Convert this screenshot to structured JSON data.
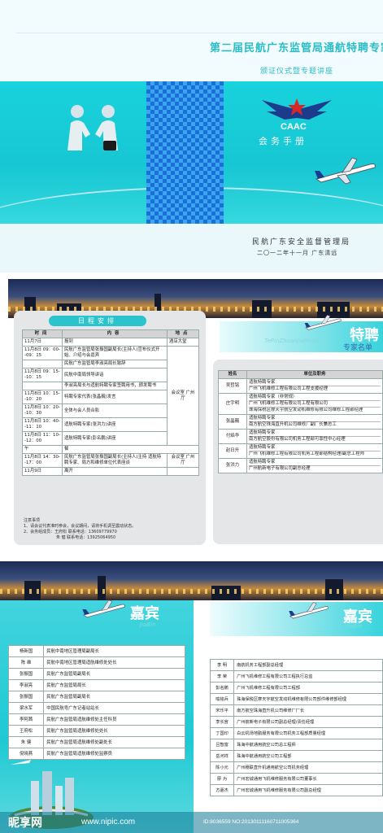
{
  "cover": {
    "title": "第二届民航广东监管局通航特聘专家",
    "subtitle": "颁证仪式暨专题讲座",
    "logo_text": "CAAC",
    "handbook": "会务手册",
    "org": "民航广东安全监督管理局",
    "date": "二〇一二年十一月  广东清远"
  },
  "schedule": {
    "header": "日程安排",
    "columns": [
      "时间",
      "内容",
      "地点"
    ],
    "rows": [
      {
        "time": "11月7日",
        "content": "报到",
        "place": "酒店大堂"
      },
      {
        "time": "11月8日 09：00--09：15",
        "content": "民航广东监管局张振国副局长(主持人)宣布仪式开始、介绍与会嘉宾",
        "place": ""
      },
      {
        "time": "",
        "content": "民航广东监管局李淑亮局长致辞",
        "place": ""
      },
      {
        "time": "11月8日 09：15--10：15",
        "content": "民航中南局领导讲话",
        "place": ""
      },
      {
        "time": "",
        "content": "李淑亮局长与适航特聘专家签聘用书，颁发聘书",
        "place": ""
      },
      {
        "time": "11月8日 10：15--10：20",
        "content": "特聘专家代表(张晶巍)发言",
        "place": "会议室 广州厅"
      },
      {
        "time": "11月8日 10：20--10：30",
        "content": "全体与会人员合影",
        "place": ""
      },
      {
        "time": "11月8日 10：40--11：10",
        "content": "适航特聘专家(张洪力)讲座",
        "place": ""
      },
      {
        "time": "11月8日 11：10--12：00",
        "content": "适航特聘专家(彭名鹏)讲座",
        "place": ""
      },
      {
        "time": "午",
        "content": "餐",
        "place": ""
      },
      {
        "time": "11月8日 14：30--17：00",
        "content": "民航广东监管局张振国副局长(主持人)主持 适航特聘专家、局方和维修单位代表座谈",
        "place": "会议室 广州厅"
      },
      {
        "time": "11月9日",
        "content": "离开",
        "place": ""
      }
    ],
    "note_title": "注意事项",
    "notes": [
      "1、请会议代表准时参会，会议期间，请将手机调至震动状态。",
      "2、会务组成员：王府松    联系电话：13609779970",
      "朱  健    联系电话：13925064950"
    ]
  },
  "experts": {
    "title": "特聘",
    "pinyin": "TePinZhuanJiaMingDan",
    "subtitle": "专家名单",
    "columns": [
      "姓名",
      "单位及职务"
    ],
    "rows": [
      {
        "name": "吴哲铭",
        "lines": [
          "适航特聘专家",
          "广州飞机维修工程有限公司工程支援经理"
        ]
      },
      {
        "name": "庄宇明",
        "lines": [
          "适航特聘专家（非常规）",
          "广州飞机维修工程有限公司工程有限公司",
          "珠海保税区摩天宇航空发动机维修有限公司维修工程部经理"
        ]
      },
      {
        "name": "张晶巍",
        "lines": [
          "适航特聘专家",
          "南方航空珠海直升机公司维修厂副厂长兼总工"
        ]
      },
      {
        "name": "付焰华",
        "lines": [
          "适航特聘专家",
          "南方航空股份有限公司机务工程部可靠性中心经理"
        ]
      },
      {
        "name": "赵日升",
        "lines": [
          "适航特聘专家",
          "广州飞机维修工程有限公司机务工程部结构经理/副总工程师"
        ]
      },
      {
        "name": "张洪力",
        "lines": [
          "适航特聘专家",
          "广州航新电子有限公司副总经理"
        ]
      }
    ]
  },
  "guests_left": {
    "title": "嘉宾",
    "pinyin": "JiaBin",
    "rows": [
      {
        "name": "杨新国",
        "title": "民航中南地区管理局副局长"
      },
      {
        "name": "陈  维",
        "title": "民航中南地区管理局适航维修处处长"
      },
      {
        "name": "张振国",
        "title": "民航广东监管局副局长"
      },
      {
        "name": "李淑亮",
        "title": "民航广东监管局局长"
      },
      {
        "name": "张振国",
        "title": "民航广东监管局副局长"
      },
      {
        "name": "梁水军",
        "title": "中国民航粤广东记者站站长"
      },
      {
        "name": "李阿茜",
        "title": "民航广东监管局适航维修处主任科员"
      },
      {
        "name": "王府松",
        "title": "民航广东监管局适航维修处处长"
      },
      {
        "name": "朱  健",
        "title": "民航广东监管局适航维修处副处长"
      },
      {
        "name": "倪晓燕",
        "title": "民航广东监管局适航维修处监察员"
      }
    ]
  },
  "guests_right": {
    "title": "嘉宾",
    "pinyin": "JiaBin",
    "rows": [
      {
        "name": "李  明",
        "title": "南航机务工程部副总经理"
      },
      {
        "name": "李  荣",
        "title": "广州飞机维修工程有限公司工程执行总监"
      },
      {
        "name": "彭名鹏",
        "title": "广州飞机维修工程有限公司工程部"
      },
      {
        "name": "喻铭兵",
        "title": "珠海保税区摩天宇航空发动机维修有限公司部件维修部经理"
      },
      {
        "name": "宋乐平",
        "title": "南方航空珠海直升机公司维修厂厂长"
      },
      {
        "name": "李长宫",
        "title": "广州航新电子有限公司副总经理/责任经理"
      },
      {
        "name": "丁国印",
        "title": "白云机场地勤服务有限公司机务工程部质量经理"
      },
      {
        "name": "吕智富",
        "title": "珠海中航通用航空公司总工程师"
      },
      {
        "name": "岳河祥",
        "title": "珠海中航通用航空公司工程部"
      },
      {
        "name": "陈小元",
        "title": "广州穗联直升机通用航空公司机务经理"
      },
      {
        "name": "廖  为",
        "title": "广州宏诚通用飞机维修服务有限公司董事长"
      },
      {
        "name": "方嘉杰",
        "title": "广州宏诚通用飞机维修服务有限公司副总经理"
      }
    ]
  },
  "watermark": {
    "logo": "昵享网",
    "url": "www.nipic.com",
    "id": "ID:8036559 NO:20130111160711005364"
  }
}
